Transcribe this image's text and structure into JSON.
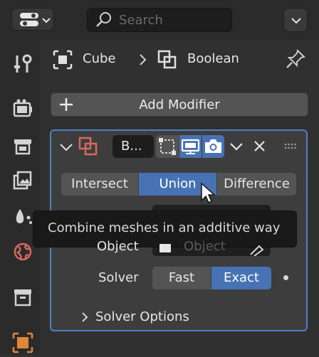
{
  "header": {
    "search_placeholder": "Search"
  },
  "sidebar": {
    "items": [
      {
        "icon": "tool-icon"
      },
      {
        "icon": "render-icon"
      },
      {
        "icon": "output-icon"
      },
      {
        "icon": "view-layer-icon"
      },
      {
        "icon": "scene-icon"
      },
      {
        "icon": "world-icon"
      },
      {
        "icon": "collection-icon"
      },
      {
        "icon": "object-icon"
      }
    ]
  },
  "breadcrumb": {
    "object_name": "Cube",
    "modifier_name": "Boolean"
  },
  "add_modifier_label": "Add Modifier",
  "modifier": {
    "name_truncated": "B...",
    "operations": [
      "Intersect",
      "Union",
      "Difference"
    ],
    "selected_operation": "Union",
    "object_label": "Object",
    "object_placeholder": "Object",
    "solver_label": "Solver",
    "solver_options": [
      "Fast",
      "Exact"
    ],
    "selected_solver": "Exact",
    "solver_options_label": "Solver Options"
  },
  "tooltip": {
    "text": "Combine meshes in an additive way"
  },
  "colors": {
    "accent": "#4f7fc4",
    "selected": "#4772b3",
    "panel": "#3d3d3d",
    "object_icon": "#e0873a"
  }
}
